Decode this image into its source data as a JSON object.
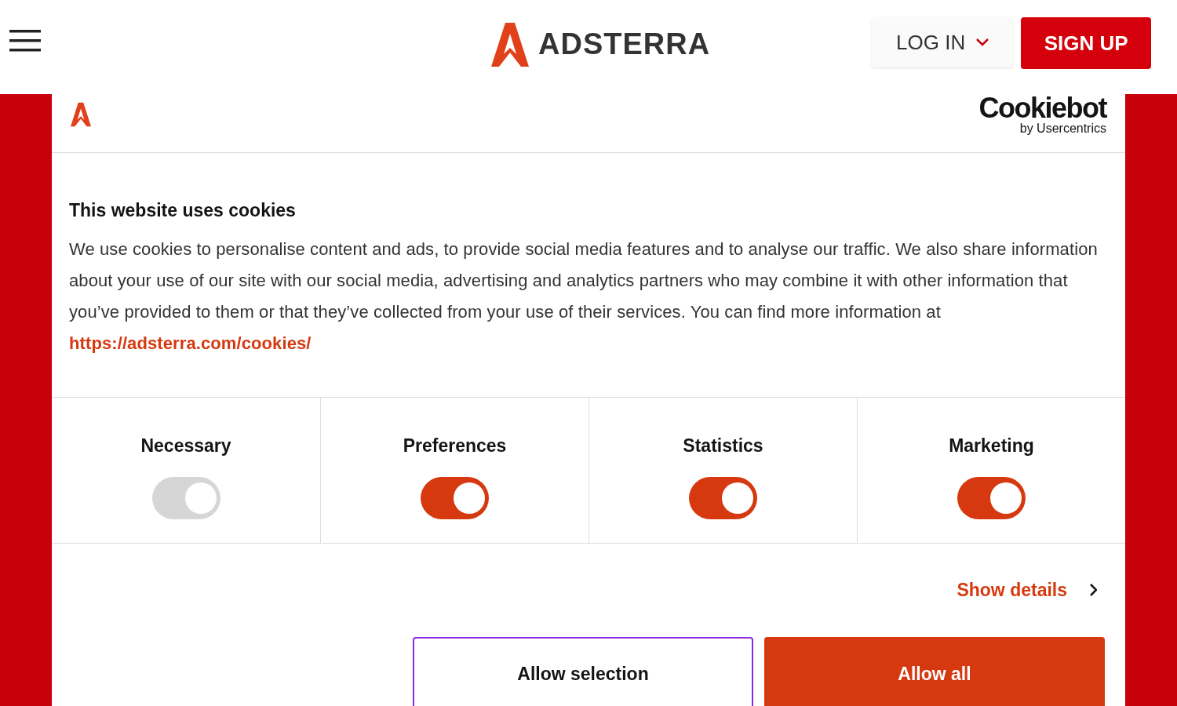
{
  "header": {
    "brand": "ADSTERRA",
    "login": "LOG IN",
    "signup": "SIGN UP"
  },
  "dialog": {
    "provider": "Cookiebot",
    "provider_sub": "by Usercentrics",
    "title": "This website uses cookies",
    "body": "We use cookies to personalise content and ads, to provide social media features and to analyse our traffic. We also share information about your use of our site with our social media, advertising and analytics partners who may combine it with other information that you’ve provided to them or that they’ve collected from your use of their services. You can find more information at ",
    "link": "https://adsterra.com/cookies/",
    "categories": [
      {
        "label": "Necessary",
        "on": true,
        "disabled": true
      },
      {
        "label": "Preferences",
        "on": true,
        "disabled": false
      },
      {
        "label": "Statistics",
        "on": true,
        "disabled": false
      },
      {
        "label": "Marketing",
        "on": true,
        "disabled": false
      }
    ],
    "show_details": "Show details",
    "buttons": [
      {
        "label": "Allow selection",
        "kind": "outline"
      },
      {
        "label": "Allow all",
        "kind": "primary"
      }
    ]
  }
}
